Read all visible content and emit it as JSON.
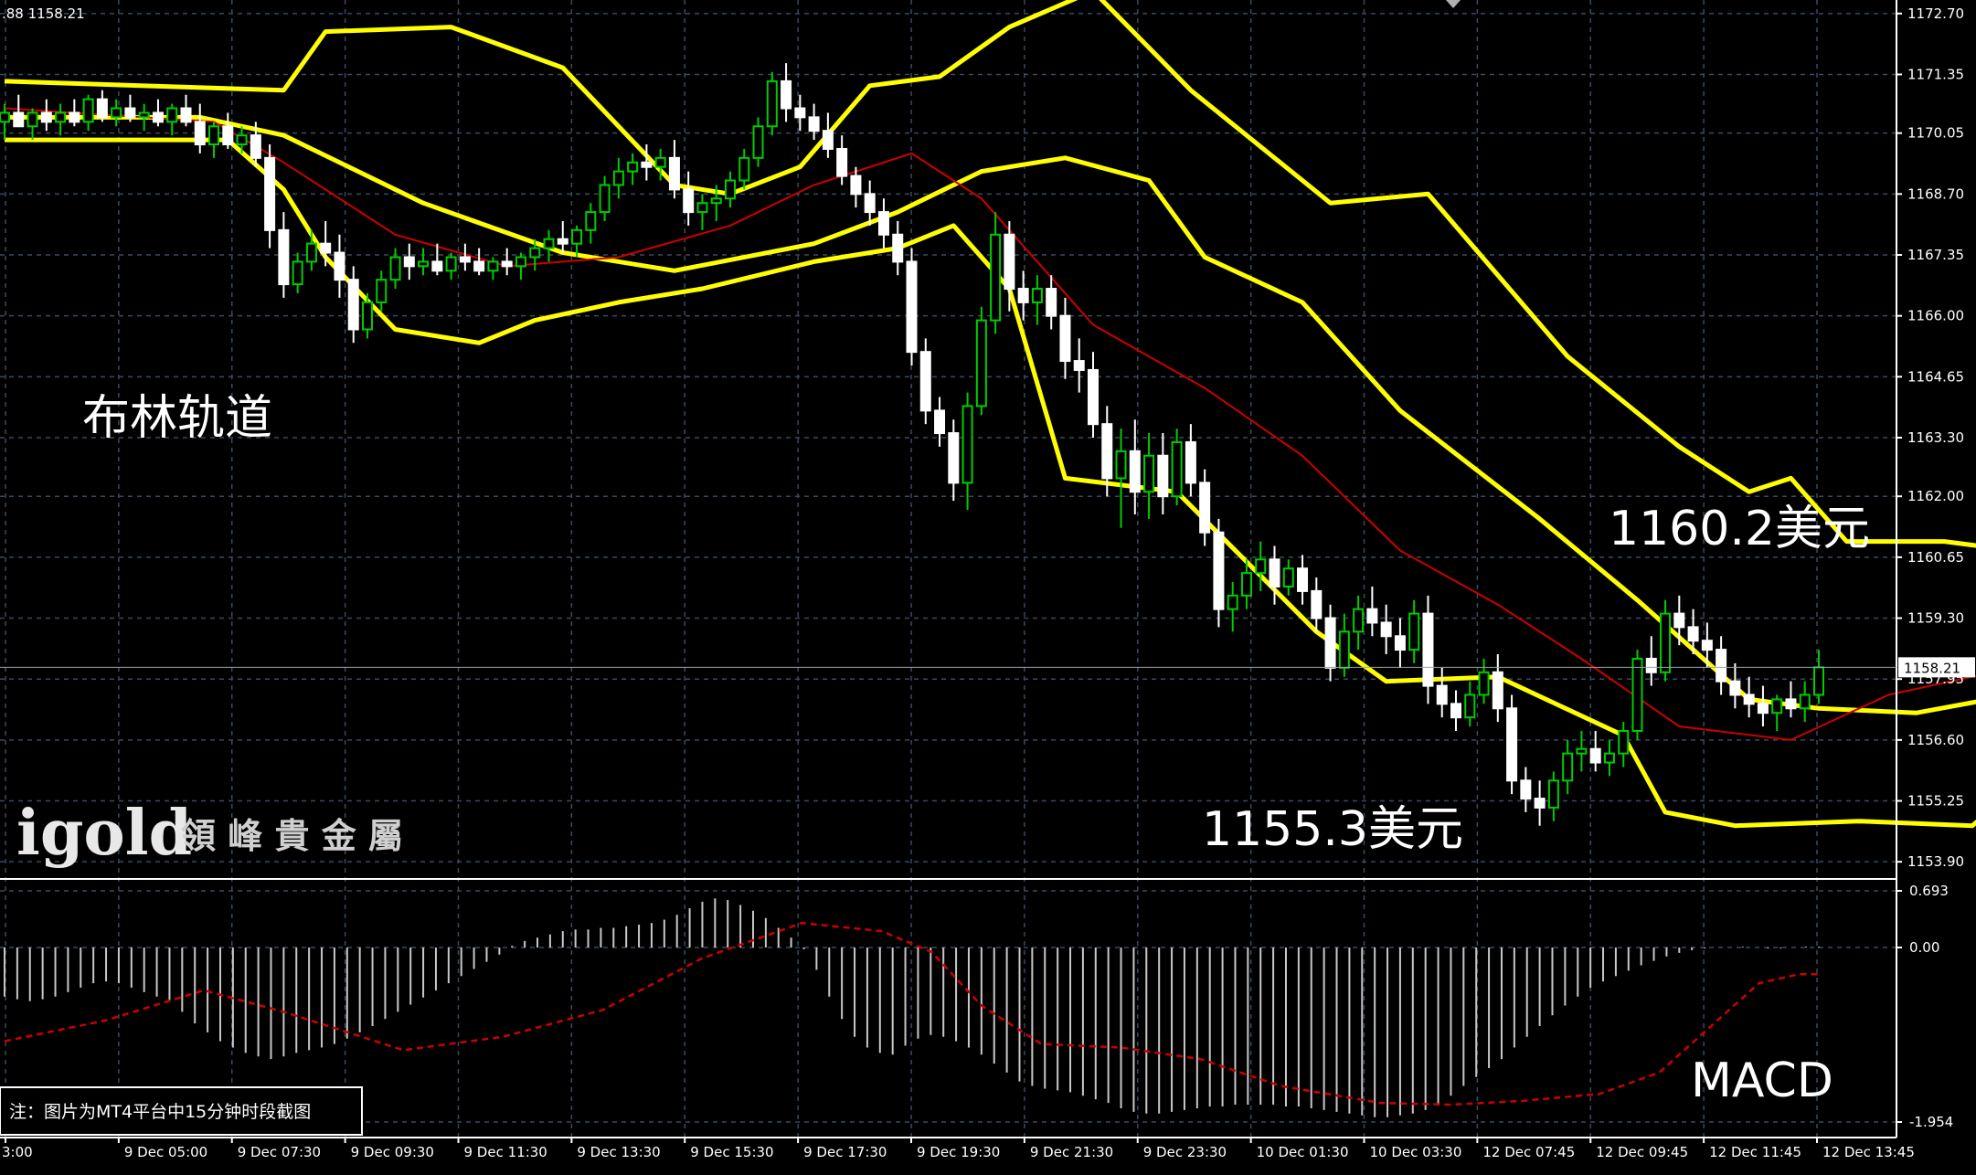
{
  "header": {
    "text": ".88 1158.21"
  },
  "colors": {
    "background": "#000000",
    "grid": "#3a4a60",
    "bull": "#00cc00",
    "bear": "#ffffff",
    "bollinger": "#ffff00",
    "ma": "#cc0000",
    "macd_hist": "#c8c8c8",
    "macd_signal": "#cc0000"
  },
  "annotations": {
    "bollinger_label": "布林轨道",
    "upper_price": "1160.2美元",
    "lower_price": "1155.3美元",
    "macd_label": "MACD",
    "note": "注：图片为MT4平台中15分钟时段截图",
    "brand_en": "igold",
    "brand_cn": "領 峰 貴 金 屬"
  },
  "price_axis": {
    "ticks": [
      "1172.70",
      "1171.35",
      "1170.05",
      "1168.70",
      "1167.35",
      "1166.00",
      "1164.65",
      "1163.30",
      "1162.00",
      "1160.65",
      "1159.30",
      "1157.95",
      "1156.60",
      "1155.25",
      "1153.90"
    ],
    "current": "1158.21"
  },
  "macd_axis": {
    "ticks": [
      "0.693",
      "0.00",
      "-1.954"
    ]
  },
  "time_axis": {
    "labels": [
      "3:00",
      "9 Dec 05:00",
      "9 Dec 07:30",
      "9 Dec 09:30",
      "9 Dec 11:30",
      "9 Dec 13:30",
      "9 Dec 15:30",
      "9 Dec 17:30",
      "9 Dec 19:30",
      "9 Dec 21:30",
      "9 Dec 23:30",
      "10 Dec 01:30",
      "10 Dec 03:30",
      "12 Dec 07:45",
      "12 Dec 09:45",
      "12 Dec 11:45",
      "12 Dec 13:45"
    ]
  },
  "chart_data": {
    "type": "candlestick",
    "symbol_timeframe": "15-minute",
    "price_range": [
      1153.6,
      1173.0
    ],
    "current_price": 1158.21,
    "candles": [
      [
        1170.3,
        1170.7,
        1169.9,
        1170.5
      ],
      [
        1170.5,
        1170.9,
        1170.2,
        1170.2
      ],
      [
        1170.2,
        1170.6,
        1169.9,
        1170.5
      ],
      [
        1170.5,
        1170.8,
        1170.1,
        1170.3
      ],
      [
        1170.3,
        1170.7,
        1170.0,
        1170.5
      ],
      [
        1170.5,
        1170.8,
        1170.2,
        1170.3
      ],
      [
        1170.3,
        1170.9,
        1170.1,
        1170.8
      ],
      [
        1170.8,
        1171.0,
        1170.3,
        1170.4
      ],
      [
        1170.4,
        1170.8,
        1170.2,
        1170.6
      ],
      [
        1170.6,
        1170.9,
        1170.3,
        1170.4
      ],
      [
        1170.4,
        1170.7,
        1170.1,
        1170.5
      ],
      [
        1170.5,
        1170.8,
        1170.2,
        1170.3
      ],
      [
        1170.3,
        1170.7,
        1170.0,
        1170.6
      ],
      [
        1170.6,
        1170.9,
        1170.2,
        1170.3
      ],
      [
        1170.3,
        1170.7,
        1169.6,
        1169.8
      ],
      [
        1169.8,
        1170.3,
        1169.5,
        1170.2
      ],
      [
        1170.2,
        1170.5,
        1169.7,
        1169.8
      ],
      [
        1169.8,
        1170.2,
        1169.6,
        1170.0
      ],
      [
        1170.0,
        1170.3,
        1169.3,
        1169.5
      ],
      [
        1169.5,
        1169.8,
        1167.5,
        1167.9
      ],
      [
        1167.9,
        1168.3,
        1166.4,
        1166.7
      ],
      [
        1166.7,
        1167.4,
        1166.5,
        1167.2
      ],
      [
        1167.2,
        1167.9,
        1167.0,
        1167.6
      ],
      [
        1167.6,
        1168.1,
        1167.1,
        1167.4
      ],
      [
        1167.4,
        1167.8,
        1166.4,
        1166.8
      ],
      [
        1166.8,
        1167.1,
        1165.4,
        1165.7
      ],
      [
        1165.7,
        1166.5,
        1165.5,
        1166.3
      ],
      [
        1166.3,
        1167.0,
        1166.1,
        1166.8
      ],
      [
        1166.8,
        1167.5,
        1166.6,
        1167.3
      ],
      [
        1167.3,
        1167.6,
        1166.8,
        1167.1
      ],
      [
        1167.1,
        1167.5,
        1166.9,
        1167.2
      ],
      [
        1167.2,
        1167.6,
        1166.9,
        1167.0
      ],
      [
        1167.0,
        1167.4,
        1166.8,
        1167.3
      ],
      [
        1167.3,
        1167.6,
        1167.0,
        1167.2
      ],
      [
        1167.2,
        1167.5,
        1166.9,
        1167.0
      ],
      [
        1167.0,
        1167.3,
        1166.8,
        1167.2
      ],
      [
        1167.2,
        1167.5,
        1166.9,
        1167.1
      ],
      [
        1167.1,
        1167.4,
        1166.8,
        1167.3
      ],
      [
        1167.3,
        1167.7,
        1167.0,
        1167.5
      ],
      [
        1167.5,
        1167.9,
        1167.2,
        1167.7
      ],
      [
        1167.7,
        1168.1,
        1167.4,
        1167.6
      ],
      [
        1167.6,
        1168.0,
        1167.3,
        1167.9
      ],
      [
        1167.9,
        1168.5,
        1167.6,
        1168.3
      ],
      [
        1168.3,
        1169.1,
        1168.1,
        1168.9
      ],
      [
        1168.9,
        1169.5,
        1168.6,
        1169.2
      ],
      [
        1169.2,
        1169.6,
        1168.9,
        1169.4
      ],
      [
        1169.4,
        1169.8,
        1169.0,
        1169.3
      ],
      [
        1169.3,
        1169.7,
        1169.0,
        1169.5
      ],
      [
        1169.5,
        1169.9,
        1168.6,
        1168.8
      ],
      [
        1168.8,
        1169.2,
        1168.0,
        1168.3
      ],
      [
        1168.3,
        1168.7,
        1167.9,
        1168.5
      ],
      [
        1168.5,
        1168.9,
        1168.1,
        1168.6
      ],
      [
        1168.6,
        1169.2,
        1168.4,
        1169.0
      ],
      [
        1169.0,
        1169.7,
        1168.8,
        1169.5
      ],
      [
        1169.5,
        1170.4,
        1169.3,
        1170.2
      ],
      [
        1170.2,
        1171.4,
        1170.0,
        1171.2
      ],
      [
        1171.2,
        1171.6,
        1170.3,
        1170.6
      ],
      [
        1170.6,
        1170.9,
        1170.1,
        1170.4
      ],
      [
        1170.4,
        1170.7,
        1169.9,
        1170.1
      ],
      [
        1170.1,
        1170.5,
        1169.5,
        1169.7
      ],
      [
        1169.7,
        1170.0,
        1168.9,
        1169.1
      ],
      [
        1169.1,
        1169.3,
        1168.4,
        1168.7
      ],
      [
        1168.7,
        1169.0,
        1168.0,
        1168.3
      ],
      [
        1168.3,
        1168.6,
        1167.5,
        1167.8
      ],
      [
        1167.8,
        1168.1,
        1166.9,
        1167.2
      ],
      [
        1167.2,
        1167.5,
        1164.9,
        1165.2
      ],
      [
        1165.2,
        1165.5,
        1163.6,
        1163.9
      ],
      [
        1163.9,
        1164.2,
        1163.1,
        1163.4
      ],
      [
        1163.4,
        1163.7,
        1161.9,
        1162.3
      ],
      [
        1162.3,
        1164.3,
        1161.7,
        1164.0
      ],
      [
        1164.0,
        1166.2,
        1163.8,
        1165.9
      ],
      [
        1165.9,
        1168.3,
        1165.6,
        1167.8
      ],
      [
        1167.8,
        1168.1,
        1166.1,
        1166.6
      ],
      [
        1166.6,
        1167.0,
        1165.9,
        1166.3
      ],
      [
        1166.3,
        1166.9,
        1165.8,
        1166.6
      ],
      [
        1166.6,
        1166.9,
        1165.7,
        1166.0
      ],
      [
        1166.0,
        1166.4,
        1164.6,
        1165.0
      ],
      [
        1165.0,
        1165.5,
        1164.3,
        1164.8
      ],
      [
        1164.8,
        1165.2,
        1163.3,
        1163.6
      ],
      [
        1163.6,
        1164.0,
        1162.0,
        1162.4
      ],
      [
        1162.4,
        1163.5,
        1161.3,
        1163.0
      ],
      [
        1163.0,
        1163.7,
        1161.6,
        1162.1
      ],
      [
        1162.1,
        1163.4,
        1161.5,
        1162.9
      ],
      [
        1162.9,
        1163.4,
        1161.6,
        1162.0
      ],
      [
        1162.0,
        1163.5,
        1161.8,
        1163.2
      ],
      [
        1163.2,
        1163.6,
        1162.0,
        1162.3
      ],
      [
        1162.3,
        1162.6,
        1160.9,
        1161.2
      ],
      [
        1161.2,
        1161.5,
        1159.1,
        1159.5
      ],
      [
        1159.5,
        1160.1,
        1159.0,
        1159.8
      ],
      [
        1159.8,
        1160.6,
        1159.5,
        1160.3
      ],
      [
        1160.3,
        1161.0,
        1159.9,
        1160.6
      ],
      [
        1160.6,
        1160.9,
        1159.6,
        1160.0
      ],
      [
        1160.0,
        1160.6,
        1159.8,
        1160.4
      ],
      [
        1160.4,
        1160.7,
        1159.6,
        1159.9
      ],
      [
        1159.9,
        1160.2,
        1159.0,
        1159.3
      ],
      [
        1159.3,
        1159.6,
        1157.9,
        1158.2
      ],
      [
        1158.2,
        1159.4,
        1158.0,
        1159.0
      ],
      [
        1159.0,
        1159.8,
        1158.6,
        1159.5
      ],
      [
        1159.5,
        1160.0,
        1158.9,
        1159.2
      ],
      [
        1159.2,
        1159.6,
        1158.5,
        1158.9
      ],
      [
        1158.9,
        1159.3,
        1158.2,
        1158.6
      ],
      [
        1158.6,
        1159.7,
        1158.3,
        1159.4
      ],
      [
        1159.4,
        1159.8,
        1157.4,
        1157.8
      ],
      [
        1157.8,
        1158.2,
        1157.1,
        1157.4
      ],
      [
        1157.4,
        1157.7,
        1156.8,
        1157.1
      ],
      [
        1157.1,
        1157.9,
        1156.9,
        1157.6
      ],
      [
        1157.6,
        1158.4,
        1157.4,
        1158.1
      ],
      [
        1158.1,
        1158.5,
        1157.0,
        1157.3
      ],
      [
        1157.3,
        1157.6,
        1155.4,
        1155.7
      ],
      [
        1155.7,
        1156.0,
        1155.0,
        1155.3
      ],
      [
        1155.3,
        1155.7,
        1154.7,
        1155.1
      ],
      [
        1155.1,
        1155.9,
        1154.8,
        1155.7
      ],
      [
        1155.7,
        1156.6,
        1155.4,
        1156.3
      ],
      [
        1156.3,
        1156.8,
        1155.9,
        1156.4
      ],
      [
        1156.4,
        1156.8,
        1155.9,
        1156.1
      ],
      [
        1156.1,
        1156.6,
        1155.8,
        1156.3
      ],
      [
        1156.3,
        1157.0,
        1156.0,
        1156.8
      ],
      [
        1156.8,
        1158.6,
        1156.6,
        1158.4
      ],
      [
        1158.4,
        1158.9,
        1157.8,
        1158.1
      ],
      [
        1158.1,
        1159.7,
        1157.9,
        1159.4
      ],
      [
        1159.4,
        1159.8,
        1158.7,
        1159.1
      ],
      [
        1159.1,
        1159.5,
        1158.5,
        1158.8
      ],
      [
        1158.8,
        1159.2,
        1158.2,
        1158.6
      ],
      [
        1158.6,
        1158.9,
        1157.6,
        1157.9
      ],
      [
        1157.9,
        1158.3,
        1157.3,
        1157.6
      ],
      [
        1157.6,
        1158.0,
        1157.1,
        1157.4
      ],
      [
        1157.4,
        1157.8,
        1156.9,
        1157.2
      ],
      [
        1157.2,
        1157.6,
        1156.8,
        1157.5
      ],
      [
        1157.5,
        1157.9,
        1157.1,
        1157.3
      ],
      [
        1157.3,
        1157.9,
        1157.0,
        1157.6
      ],
      [
        1157.6,
        1158.6,
        1157.4,
        1158.21
      ]
    ],
    "bollinger": {
      "upper": [
        [
          0,
          1171.2
        ],
        [
          20,
          1171.0
        ],
        [
          23,
          1172.3
        ],
        [
          32,
          1172.4
        ],
        [
          40,
          1171.5
        ],
        [
          48,
          1168.9
        ],
        [
          52,
          1168.7
        ],
        [
          57,
          1169.3
        ],
        [
          62,
          1171.1
        ],
        [
          67,
          1171.3
        ],
        [
          72,
          1172.4
        ],
        [
          78,
          1173.2
        ],
        [
          85,
          1171.0
        ],
        [
          95,
          1168.5
        ],
        [
          102,
          1168.7
        ],
        [
          112,
          1165.1
        ],
        [
          120,
          1163.1
        ],
        [
          125,
          1162.1
        ],
        [
          128,
          1162.4
        ],
        [
          132,
          1161.0
        ],
        [
          139,
          1161.0
        ],
        [
          144,
          1160.8
        ]
      ],
      "middle": [
        [
          0,
          1170.4
        ],
        [
          14,
          1170.4
        ],
        [
          20,
          1170.0
        ],
        [
          30,
          1168.5
        ],
        [
          40,
          1167.4
        ],
        [
          48,
          1167.0
        ],
        [
          58,
          1167.6
        ],
        [
          64,
          1168.3
        ],
        [
          70,
          1169.2
        ],
        [
          76,
          1169.5
        ],
        [
          82,
          1169.0
        ],
        [
          86,
          1167.3
        ],
        [
          93,
          1166.3
        ],
        [
          100,
          1163.9
        ],
        [
          110,
          1161.5
        ],
        [
          117,
          1159.7
        ],
        [
          125,
          1157.5
        ],
        [
          130,
          1157.3
        ],
        [
          137,
          1157.2
        ],
        [
          144,
          1157.6
        ]
      ],
      "lower": [
        [
          0,
          1169.9
        ],
        [
          16,
          1169.9
        ],
        [
          20,
          1168.8
        ],
        [
          23,
          1167.3
        ],
        [
          28,
          1165.7
        ],
        [
          34,
          1165.4
        ],
        [
          38,
          1165.9
        ],
        [
          44,
          1166.3
        ],
        [
          50,
          1166.6
        ],
        [
          58,
          1167.2
        ],
        [
          64,
          1167.5
        ],
        [
          68,
          1168.0
        ],
        [
          72,
          1166.6
        ],
        [
          76,
          1162.4
        ],
        [
          84,
          1162.1
        ],
        [
          94,
          1159.0
        ],
        [
          99,
          1157.9
        ],
        [
          107,
          1158.0
        ],
        [
          116,
          1156.7
        ],
        [
          119,
          1155.0
        ],
        [
          124,
          1154.7
        ],
        [
          133,
          1154.8
        ],
        [
          141,
          1154.7
        ],
        [
          144,
          1155.5
        ]
      ]
    },
    "moving_average": [
      [
        0,
        1170.6
      ],
      [
        15,
        1170.3
      ],
      [
        20,
        1169.4
      ],
      [
        28,
        1167.8
      ],
      [
        36,
        1167.1
      ],
      [
        44,
        1167.3
      ],
      [
        52,
        1168.0
      ],
      [
        58,
        1168.9
      ],
      [
        65,
        1169.6
      ],
      [
        70,
        1168.6
      ],
      [
        78,
        1165.8
      ],
      [
        86,
        1164.4
      ],
      [
        93,
        1162.9
      ],
      [
        100,
        1160.8
      ],
      [
        107,
        1159.6
      ],
      [
        113,
        1158.4
      ],
      [
        120,
        1156.9
      ],
      [
        128,
        1156.6
      ],
      [
        135,
        1157.6
      ],
      [
        144,
        1158.2
      ]
    ],
    "macd": {
      "range": [
        -1.954,
        0.693
      ],
      "histogram": [
        -0.55,
        -0.58,
        -0.6,
        -0.58,
        -0.55,
        -0.5,
        -0.45,
        -0.4,
        -0.38,
        -0.4,
        -0.45,
        -0.5,
        -0.55,
        -0.6,
        -0.72,
        -0.85,
        -0.95,
        -1.05,
        -1.12,
        -1.18,
        -1.22,
        -1.25,
        -1.22,
        -1.18,
        -1.15,
        -1.12,
        -1.08,
        -1.02,
        -0.95,
        -0.88,
        -0.8,
        -0.72,
        -0.64,
        -0.56,
        -0.48,
        -0.4,
        -0.32,
        -0.24,
        -0.16,
        -0.08,
        0.02,
        0.08,
        0.12,
        0.16,
        0.2,
        0.22,
        0.22,
        0.24,
        0.24,
        0.26,
        0.28,
        0.3,
        0.34,
        0.4,
        0.48,
        0.56,
        0.6,
        0.58,
        0.52,
        0.45,
        0.36,
        0.24,
        0.12,
        -0.02,
        -0.25,
        -0.55,
        -0.8,
        -1.0,
        -1.12,
        -1.18,
        -1.2,
        -1.1,
        -1.02,
        -0.98,
        -1.0,
        -1.05,
        -1.12,
        -1.2,
        -1.3,
        -1.4,
        -1.5,
        -1.55,
        -1.58,
        -1.6,
        -1.62,
        -1.66,
        -1.7,
        -1.74,
        -1.8,
        -1.84,
        -1.86,
        -1.86,
        -1.84,
        -1.82,
        -1.8,
        -1.78,
        -1.78,
        -1.76,
        -1.76,
        -1.76,
        -1.76,
        -1.78,
        -1.78,
        -1.8,
        -1.82,
        -1.84,
        -1.86,
        -1.88,
        -1.9,
        -1.9,
        -1.88,
        -1.86,
        -1.82,
        -1.76,
        -1.66,
        -1.55,
        -1.45,
        -1.35,
        -1.25,
        -1.12,
        -1.0,
        -0.88,
        -0.76,
        -0.65,
        -0.55,
        -0.45,
        -0.38,
        -0.32,
        -0.26,
        -0.2,
        -0.15,
        -0.1,
        -0.06,
        -0.03,
        -0.01,
        0.0,
        0.0,
        0.01,
        0.0,
        -0.01,
        -0.01,
        0.0,
        0.01,
        0.01
      ],
      "signal": [
        [
          0,
          -1.05
        ],
        [
          10,
          -0.82
        ],
        [
          20,
          -0.48
        ],
        [
          28,
          -0.72
        ],
        [
          40,
          -1.15
        ],
        [
          50,
          -1.0
        ],
        [
          60,
          -0.7
        ],
        [
          70,
          -0.12
        ],
        [
          80,
          0.3
        ],
        [
          88,
          0.2
        ],
        [
          93,
          -0.05
        ],
        [
          98,
          -0.65
        ],
        [
          104,
          -1.08
        ],
        [
          112,
          -1.12
        ],
        [
          120,
          -1.25
        ],
        [
          128,
          -1.55
        ],
        [
          138,
          -1.74
        ],
        [
          145,
          -1.76
        ],
        [
          152,
          -1.72
        ],
        [
          160,
          -1.64
        ],
        [
          166,
          -1.4
        ],
        [
          172,
          -0.8
        ],
        [
          176,
          -0.4
        ],
        [
          180,
          -0.3
        ],
        [
          182,
          -0.3
        ]
      ]
    }
  }
}
